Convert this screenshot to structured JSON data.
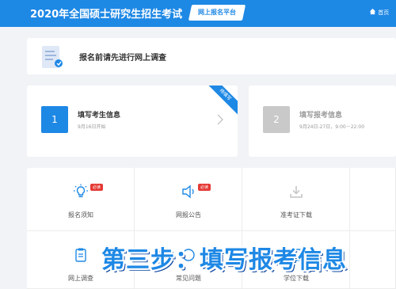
{
  "header": {
    "title": "2020年全国硕士研究生招生考试",
    "badge": "网上报名平台",
    "home": "首页"
  },
  "survey": {
    "text": "报名前请先进行网上调查"
  },
  "steps": [
    {
      "number": "1",
      "title": "填写考生信息",
      "date": "9月16日开始",
      "ribbon": "待填写"
    },
    {
      "number": "2",
      "title": "填写报考信息",
      "date": "9月24日-27日，9:00－22:00"
    }
  ],
  "grid": [
    {
      "label": "报名须知",
      "tag": "必读",
      "icon": "lightbulb-icon"
    },
    {
      "label": "网报公告",
      "tag": "必读",
      "icon": "megaphone-icon"
    },
    {
      "label": "准考证下载",
      "icon": "download-icon"
    },
    {
      "label": "网上调查",
      "icon": "clipboard-icon"
    },
    {
      "label": "常见问题",
      "icon": "question-icon"
    },
    {
      "label": "学位下载",
      "icon": "document-icon"
    }
  ],
  "overlay": {
    "text": "第三步：填写报考信息"
  },
  "colors": {
    "primary": "#1e88e5",
    "tag": "#e53935"
  }
}
